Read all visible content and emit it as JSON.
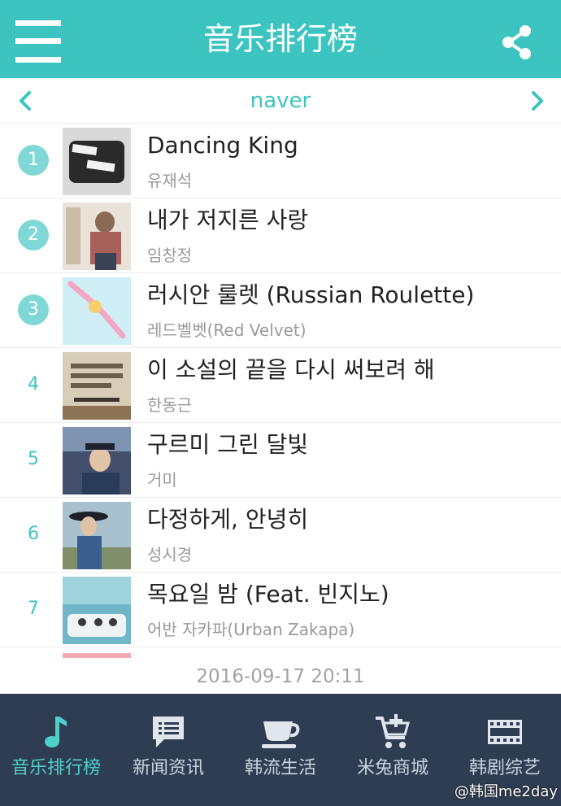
{
  "header": {
    "title": "音乐排行榜",
    "menu_icon": "hamburger-menu-icon",
    "share_icon": "share-icon"
  },
  "source_selector": {
    "name": "naver",
    "prev_icon": "chevron-left-icon",
    "next_icon": "chevron-right-icon"
  },
  "chart": [
    {
      "rank": "1",
      "title": "Dancing King",
      "artist": "유재석"
    },
    {
      "rank": "2",
      "title": "내가 저지른 사랑",
      "artist": "임창정"
    },
    {
      "rank": "3",
      "title": "러시안 룰렛 (Russian Roulette)",
      "artist": "레드벨벳(Red Velvet)"
    },
    {
      "rank": "4",
      "title": "이 소설의 끝을 다시 써보려 해",
      "artist": "한동근"
    },
    {
      "rank": "5",
      "title": "구르미 그린 달빛",
      "artist": "거미"
    },
    {
      "rank": "6",
      "title": "다정하게, 안녕히",
      "artist": "성시경"
    },
    {
      "rank": "7",
      "title": "목요일 밤 (Feat. 빈지노)",
      "artist": "어반 자카파(Urban Zakapa)"
    }
  ],
  "updated_at": "2016-09-17 20:11",
  "bottom_nav": [
    {
      "label": "音乐排行榜",
      "icon": "music-note-icon",
      "active": true
    },
    {
      "label": "新闻资讯",
      "icon": "chat-bubble-icon",
      "active": false
    },
    {
      "label": "韩流生活",
      "icon": "coffee-cup-icon",
      "active": false
    },
    {
      "label": "米兔商城",
      "icon": "shopping-cart-icon",
      "active": false
    },
    {
      "label": "韩剧综艺",
      "icon": "film-strip-icon",
      "active": false
    }
  ],
  "watermark": "@韩国me2day",
  "colors": {
    "accent": "#3cc5c0",
    "rank_badge": "#7fd8d5",
    "nav_background": "#2f3d52",
    "nav_active": "#4fcfca"
  }
}
